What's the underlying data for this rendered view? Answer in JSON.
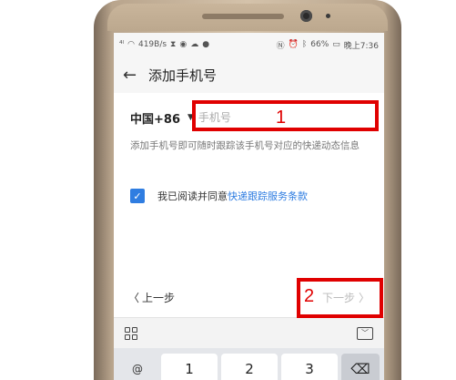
{
  "status_bar": {
    "left_text": "419B/s",
    "battery": "66%",
    "time": "晚上7:36"
  },
  "header": {
    "title": "添加手机号"
  },
  "form": {
    "country_code": "中国+86",
    "phone_placeholder": "手机号",
    "phone_value": "",
    "hint": "添加手机号即可随时跟踪该手机号对应的快递动态信息",
    "agree_checked": true,
    "agree_prefix": "我已阅读并同意",
    "agree_link": "快递跟踪服务条款"
  },
  "nav": {
    "prev_label": "上一步",
    "next_label": "下一步"
  },
  "keyboard": {
    "symbol_key": "@",
    "keys": [
      "1",
      "2",
      "3"
    ]
  },
  "annotations": {
    "box1_label": "1",
    "box2_label": "2"
  },
  "colors": {
    "accent_blue": "#2f7de1",
    "annotation_red": "#e00000"
  }
}
